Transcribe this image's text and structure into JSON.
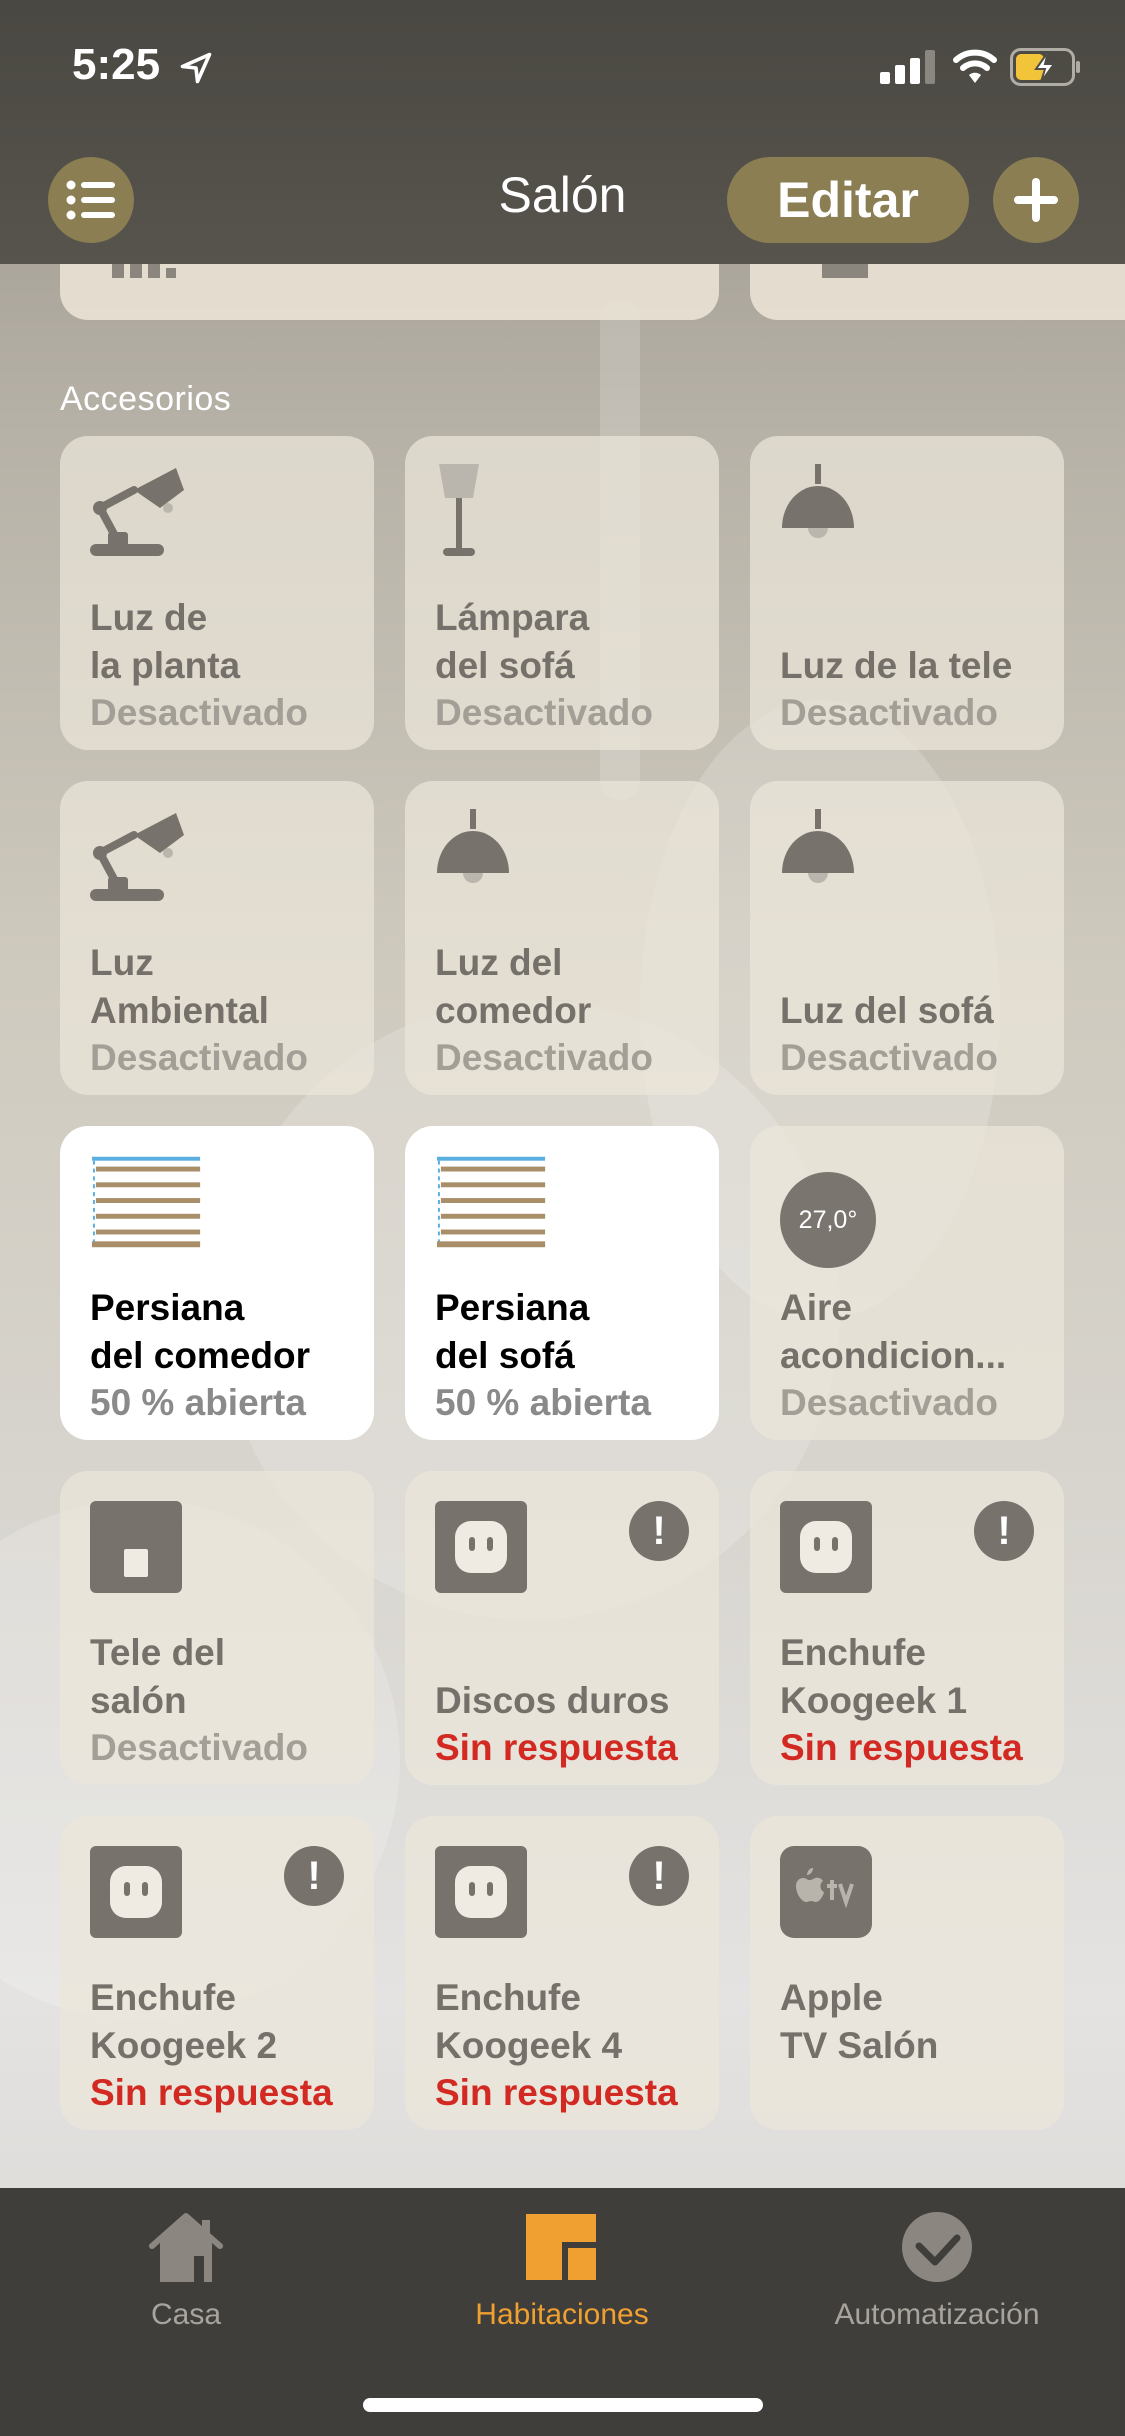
{
  "status_bar": {
    "time": "5:25"
  },
  "nav": {
    "title": "Salón",
    "edit_label": "Editar"
  },
  "section": {
    "title": "Accesorios"
  },
  "tiles": [
    {
      "name": "Luz de\nla planta",
      "status": "Desactivado",
      "icon": "desk-lamp-icon"
    },
    {
      "name": "Lámpara\ndel sofá",
      "status": "Desactivado",
      "icon": "floor-lamp-icon"
    },
    {
      "name": "Luz de la tele",
      "status": "Desactivado",
      "icon": "pendant-lamp-icon"
    },
    {
      "name": "Luz\nAmbiental",
      "status": "Desactivado",
      "icon": "desk-lamp-icon"
    },
    {
      "name": "Luz del\ncomedor",
      "status": "Desactivado",
      "icon": "pendant-lamp-icon"
    },
    {
      "name": "Luz del sofá",
      "status": "Desactivado",
      "icon": "pendant-lamp-icon"
    },
    {
      "name": "Persiana\ndel comedor",
      "status": "50 % abierta",
      "icon": "blinds-icon",
      "state": "on"
    },
    {
      "name": "Persiana\ndel sofá",
      "status": "50 % abierta",
      "icon": "blinds-icon",
      "state": "on"
    },
    {
      "name": "Aire\nacondicion...",
      "status": "Desactivado",
      "icon": "thermostat-icon",
      "temperature": "27,0°"
    },
    {
      "name": "Tele del\nsalón",
      "status": "Desactivado",
      "icon": "switch-icon"
    },
    {
      "name": "Discos duros",
      "status": "Sin respuesta",
      "icon": "outlet-icon",
      "alert": "!"
    },
    {
      "name": "Enchufe\nKoogeek 1",
      "status": "Sin respuesta",
      "icon": "outlet-icon",
      "alert": "!"
    },
    {
      "name": "Enchufe\nKoogeek 2",
      "status": "Sin respuesta",
      "icon": "outlet-icon",
      "alert": "!"
    },
    {
      "name": "Enchufe\nKoogeek 4",
      "status": "Sin respuesta",
      "icon": "outlet-icon",
      "alert": "!"
    },
    {
      "name": "Apple\nTV Salón",
      "status": "",
      "icon": "apple-tv-icon"
    }
  ],
  "tabbar": {
    "tabs": [
      {
        "label": "Casa",
        "icon": "house-icon"
      },
      {
        "label": "Habitaciones",
        "icon": "rooms-icon",
        "active": true
      },
      {
        "label": "Automatización",
        "icon": "automation-icon"
      }
    ]
  },
  "colors": {
    "accent": "#8a7e52",
    "active_tab": "#f0a030",
    "error": "#d22a22"
  }
}
